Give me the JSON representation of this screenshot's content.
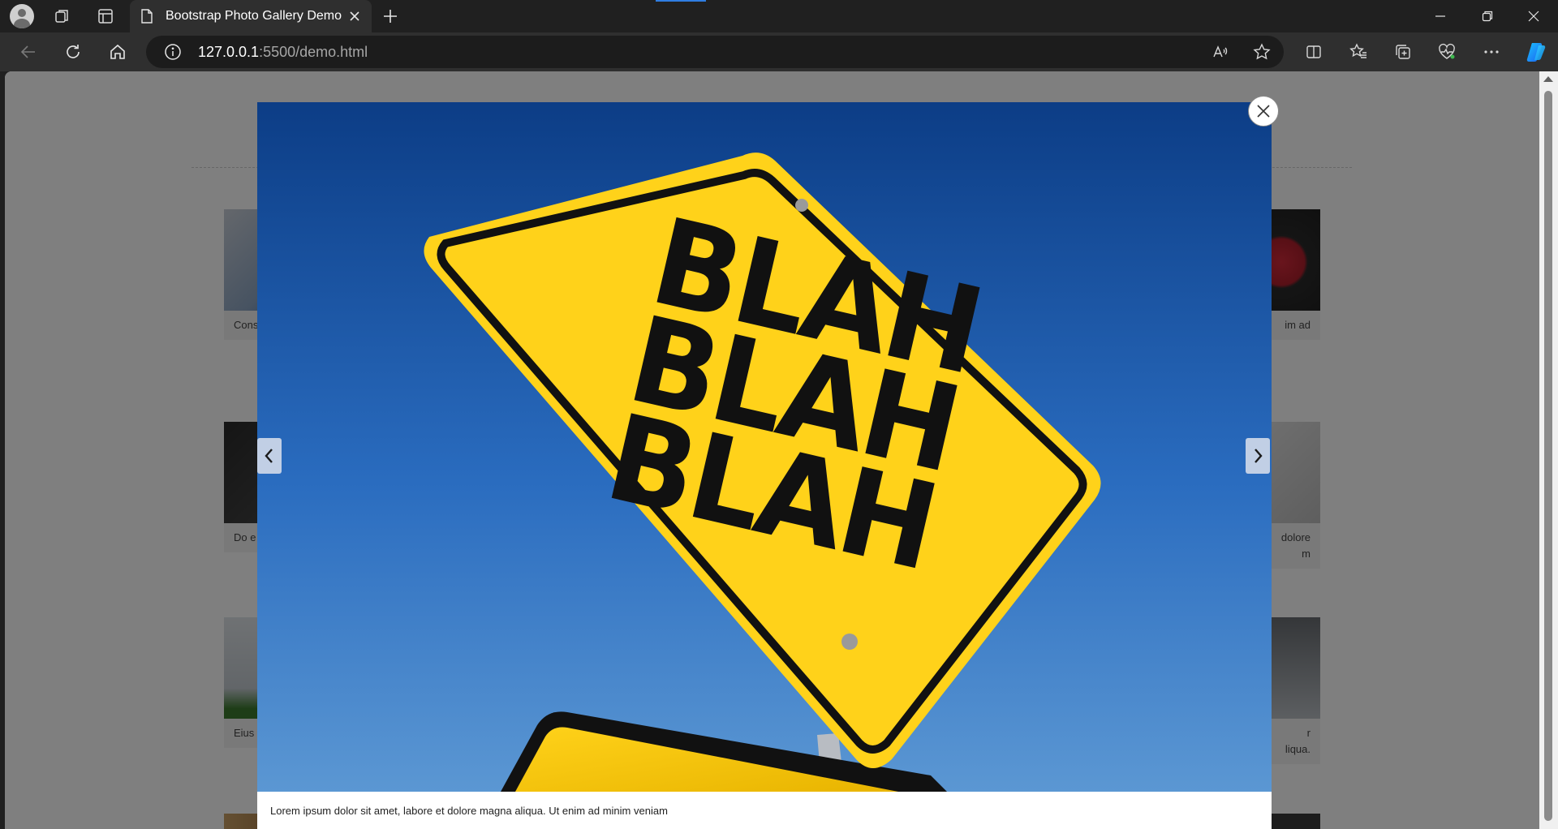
{
  "browser": {
    "tab_title": "Bootstrap Photo Gallery Demo",
    "url_host": "127.0.0.1",
    "url_rest": ":5500/demo.html"
  },
  "gallery": {
    "left_captions": [
      "Cons",
      "Do e",
      "Eius"
    ],
    "right_captions": [
      [
        "im ad"
      ],
      [
        "dolore",
        "m"
      ],
      [
        "r",
        "liqua."
      ]
    ]
  },
  "lightbox": {
    "sign_text": [
      "BLAH",
      "BLAH",
      "BLAH"
    ],
    "caption": "Lorem ipsum dolor sit amet, labore et dolore magna aliqua. Ut enim ad minim veniam"
  },
  "icons": {
    "back": "arrow-left-icon",
    "refresh": "refresh-icon",
    "home": "home-icon",
    "info": "info-icon",
    "read_aloud": "read-aloud-icon",
    "favorite": "star-icon",
    "split_screen": "split-screen-icon",
    "favorites": "favorites-icon",
    "collections": "collections-icon",
    "health": "browser-essentials-icon",
    "more": "more-icon",
    "copilot": "copilot-icon",
    "prev": "chevron-left-icon",
    "next": "chevron-right-icon",
    "close": "close-icon"
  },
  "colors": {
    "sky_top": "#0c3d86",
    "sky_bottom": "#5b97d3",
    "sign_yellow": "#f6c200"
  }
}
